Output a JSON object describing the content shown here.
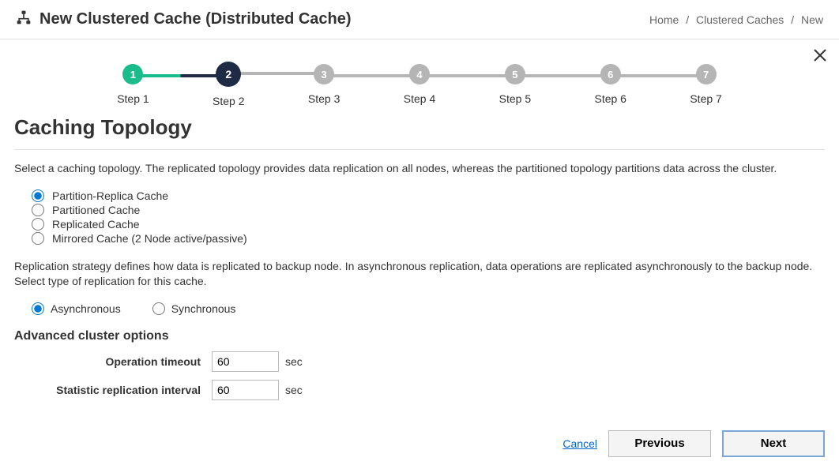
{
  "header": {
    "title": "New Clustered Cache (Distributed Cache)",
    "breadcrumb": {
      "home": "Home",
      "mid": "Clustered Caches",
      "leaf": "New"
    }
  },
  "stepper": {
    "steps": [
      {
        "num": "1",
        "label": "Step 1",
        "state": "done"
      },
      {
        "num": "2",
        "label": "Step 2",
        "state": "active"
      },
      {
        "num": "3",
        "label": "Step 3",
        "state": "future"
      },
      {
        "num": "4",
        "label": "Step 4",
        "state": "future"
      },
      {
        "num": "5",
        "label": "Step 5",
        "state": "future"
      },
      {
        "num": "6",
        "label": "Step 6",
        "state": "future"
      },
      {
        "num": "7",
        "label": "Step 7",
        "state": "future"
      }
    ]
  },
  "section": {
    "title": "Caching Topology",
    "desc": "Select a caching topology. The replicated topology provides data replication on all nodes, whereas the partitioned topology partitions data across the cluster.",
    "topology_options": [
      {
        "label": "Partition-Replica Cache",
        "checked": true
      },
      {
        "label": "Partitioned Cache",
        "checked": false
      },
      {
        "label": "Replicated Cache",
        "checked": false
      },
      {
        "label": "Mirrored Cache (2 Node active/passive)",
        "checked": false
      }
    ],
    "replication_desc": "Replication strategy defines how data is replicated to backup node. In asynchronous replication, data operations are replicated asynchronously to the backup node. Select type of replication for this cache.",
    "replication_options": [
      {
        "label": "Asynchronous",
        "checked": true
      },
      {
        "label": "Synchronous",
        "checked": false
      }
    ],
    "advanced": {
      "title": "Advanced cluster options",
      "operation_timeout": {
        "label": "Operation timeout",
        "value": "60",
        "unit": "sec"
      },
      "statistic_interval": {
        "label": "Statistic replication interval",
        "value": "60",
        "unit": "sec"
      }
    }
  },
  "footer": {
    "cancel": "Cancel",
    "previous": "Previous",
    "next": "Next"
  }
}
